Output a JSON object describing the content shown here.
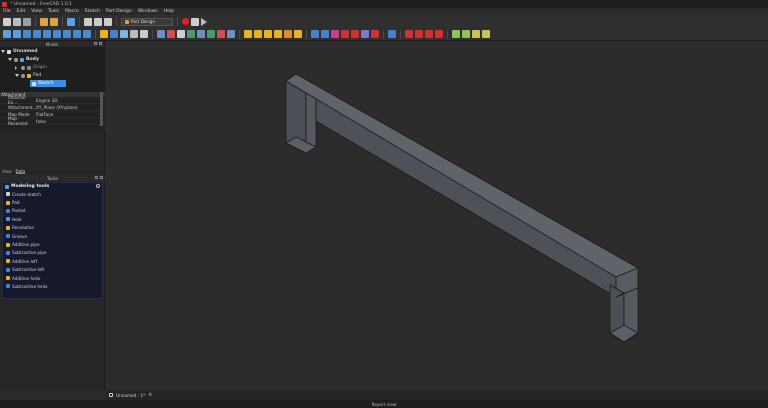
{
  "window": {
    "title": "* Unnamed - FreeCAD 1.0.1"
  },
  "menu": [
    "File",
    "Edit",
    "View",
    "Tools",
    "Macro",
    "Sketch",
    "Part Design",
    "Windows",
    "Help"
  ],
  "toolbar": {
    "workbench": "Part Design"
  },
  "model_panel": {
    "title": "Model",
    "tree": [
      {
        "label": "Unnamed",
        "level": 0,
        "icon": "document-icon"
      },
      {
        "label": "Body",
        "level": 1,
        "icon": "body-icon"
      },
      {
        "label": "Origin",
        "level": 2,
        "icon": "origin-icon"
      },
      {
        "label": "Pad",
        "level": 2,
        "icon": "pad-icon"
      },
      {
        "label": "Sketch",
        "level": 3,
        "icon": "sketch-icon"
      }
    ]
  },
  "properties": {
    "group": "Attachment",
    "rows": [
      {
        "key": "Attacher En...",
        "value": "Engine 3D"
      },
      {
        "key": "Attachment...",
        "value": "XY_Plane (XY-plane)"
      },
      {
        "key": "Map Mode",
        "value": "FlatFace"
      },
      {
        "key": "Map Reversed",
        "value": "false"
      }
    ],
    "tabs": [
      "View",
      "Data"
    ]
  },
  "tasks_panel": {
    "title": "Tasks",
    "section": "Modeling tools",
    "items": [
      {
        "label": "Create sketch",
        "color": "#d9d2c0"
      },
      {
        "label": "Pad",
        "color": "#e6b422"
      },
      {
        "label": "Pocket",
        "color": "#4a7fd0"
      },
      {
        "label": "Hole",
        "color": "#6c8fc8"
      },
      {
        "label": "Revolution",
        "color": "#e6b422"
      },
      {
        "label": "Groove",
        "color": "#4a7fd0"
      },
      {
        "label": "Additive pipe",
        "color": "#e6b422"
      },
      {
        "label": "Subtractive pipe",
        "color": "#4a7fd0"
      },
      {
        "label": "Additive loft",
        "color": "#e6b422"
      },
      {
        "label": "Subtractive loft",
        "color": "#4a7fd0"
      },
      {
        "label": "Additive helix",
        "color": "#e6b422"
      },
      {
        "label": "Subtractive helix",
        "color": "#4a7fd0"
      }
    ]
  },
  "document_tab": {
    "label": "Unnamed : 1*"
  },
  "status": {
    "text": "Report view"
  }
}
